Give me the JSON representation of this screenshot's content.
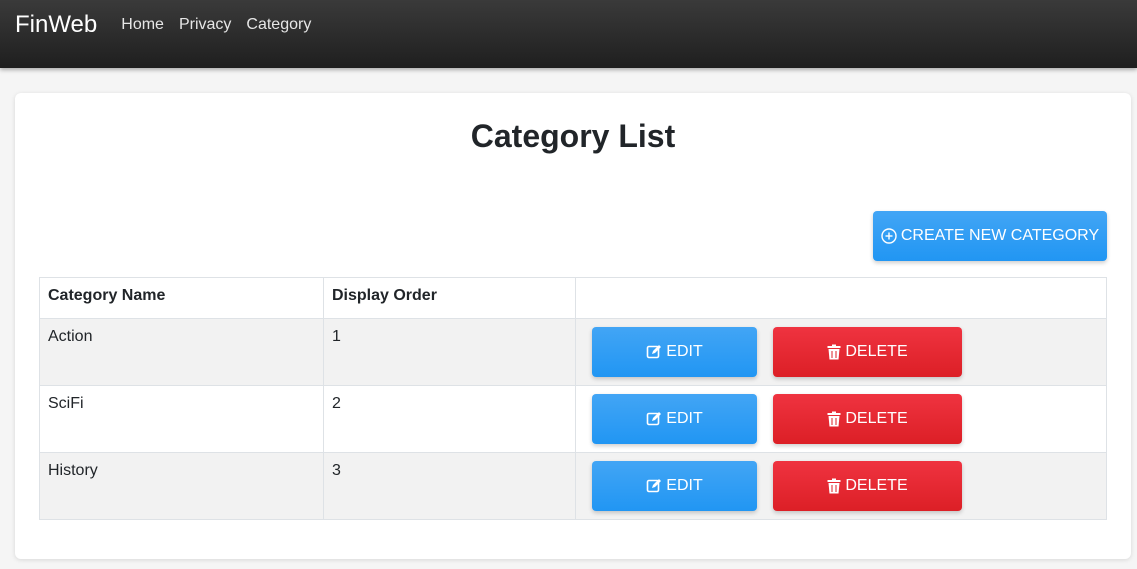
{
  "nav": {
    "brand": "FinWeb",
    "links": [
      "Home",
      "Privacy",
      "Category"
    ]
  },
  "page": {
    "title": "Category List",
    "create_button": "CREATE NEW CATEGORY"
  },
  "table": {
    "headers": [
      "Category Name",
      "Display Order",
      ""
    ],
    "rows": [
      {
        "name": "Action",
        "order": "1"
      },
      {
        "name": "SciFi",
        "order": "2"
      },
      {
        "name": "History",
        "order": "3"
      }
    ],
    "edit_label": "EDIT",
    "delete_label": "DELETE"
  },
  "colors": {
    "primary": "#2196f3",
    "danger": "#dc1f26",
    "navbar": "#2b2b2b"
  },
  "icons": {
    "create": "plus-circle-icon",
    "edit": "edit-icon",
    "delete": "trash-icon"
  }
}
